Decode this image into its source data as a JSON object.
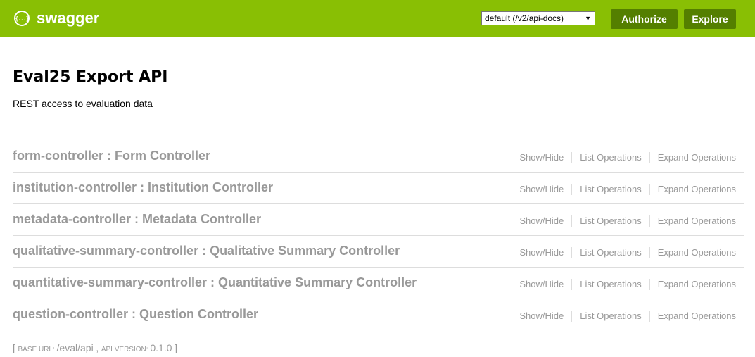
{
  "header": {
    "logo_icon": "{...}",
    "logo_text": "swagger",
    "api_select_value": "default (/v2/api-docs)",
    "authorize_label": "Authorize",
    "explore_label": "Explore",
    "colors": {
      "header_bg": "#89bf04",
      "button_bg": "#547f00"
    }
  },
  "info": {
    "title": "Eval25 Export API",
    "description": "REST access to evaluation data"
  },
  "resources": [
    {
      "heading": "form-controller : Form Controller",
      "show_hide": "Show/Hide",
      "list_operations": "List Operations",
      "expand_operations": "Expand Operations"
    },
    {
      "heading": "institution-controller : Institution Controller",
      "show_hide": "Show/Hide",
      "list_operations": "List Operations",
      "expand_operations": "Expand Operations"
    },
    {
      "heading": "metadata-controller : Metadata Controller",
      "show_hide": "Show/Hide",
      "list_operations": "List Operations",
      "expand_operations": "Expand Operations"
    },
    {
      "heading": "qualitative-summary-controller : Qualitative Summary Controller",
      "show_hide": "Show/Hide",
      "list_operations": "List Operations",
      "expand_operations": "Expand Operations"
    },
    {
      "heading": "quantitative-summary-controller : Quantitative Summary Controller",
      "show_hide": "Show/Hide",
      "list_operations": "List Operations",
      "expand_operations": "Expand Operations"
    },
    {
      "heading": "question-controller : Question Controller",
      "show_hide": "Show/Hide",
      "list_operations": "List Operations",
      "expand_operations": "Expand Operations"
    }
  ],
  "footer": {
    "open_bracket": "[",
    "base_url_label": "Base url",
    "base_url_value": "/eval/api",
    "separator": ",",
    "api_version_label": "Api version",
    "api_version_value": "0.1.0",
    "close_bracket": "]"
  }
}
